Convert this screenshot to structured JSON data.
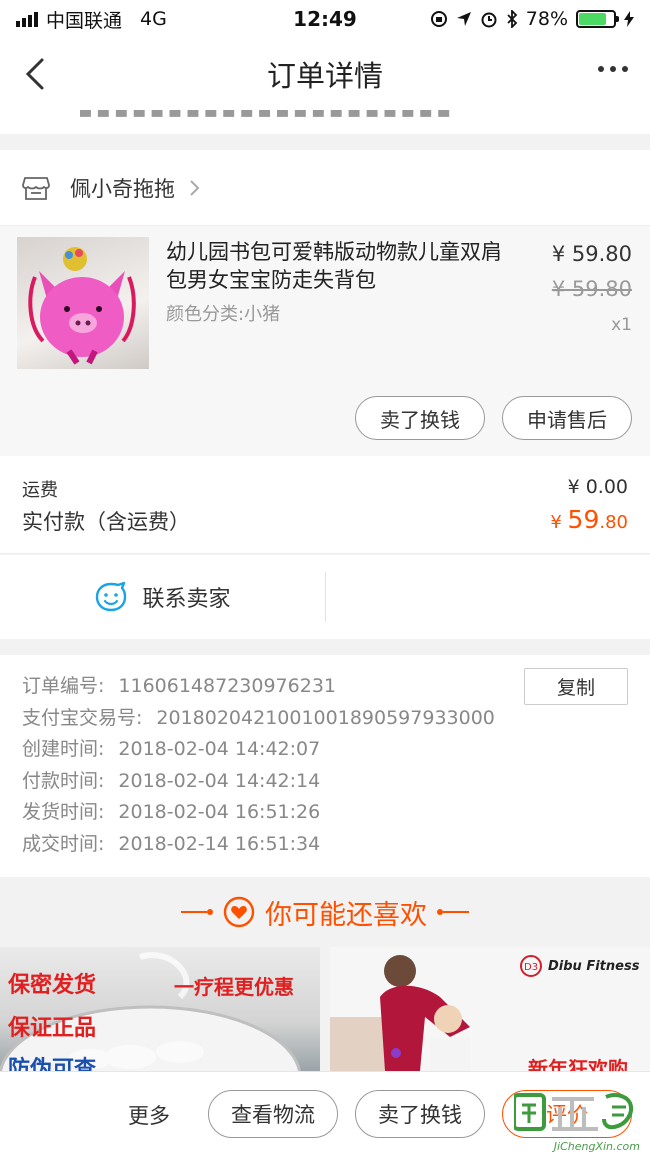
{
  "status_bar": {
    "carrier": "中国联通",
    "network": "4G",
    "time": "12:49",
    "battery": "78%",
    "battery_level": 0.78,
    "battery_color": "#4cd964"
  },
  "nav": {
    "title": "订单详情",
    "back_icon": "chevron-left-icon",
    "more_icon": "more-dots-icon"
  },
  "shop": {
    "name": "佩小奇拖拖",
    "icon": "shop-icon"
  },
  "item": {
    "title": "幼儿园书包可爱韩版动物款儿童双肩包男女宝宝防走失背包",
    "variant": "颜色分类:小猪",
    "price": "¥ 59.80",
    "original_price": "¥ 59.80",
    "quantity": "x1",
    "actions": [
      "卖了换钱",
      "申请售后"
    ]
  },
  "fees": {
    "shipping_label": "运费",
    "shipping_value": "¥ 0.00",
    "paid_label": "实付款（含运费）",
    "paid_symbol": "¥ ",
    "paid_integer": "59",
    "paid_decimal": ".80"
  },
  "contact": {
    "label": "联系卖家",
    "icon": "chat-smile-icon"
  },
  "order_info": {
    "copy_label": "复制",
    "rows": [
      {
        "key": "订单编号:",
        "value": "116061487230976231"
      },
      {
        "key": "支付宝交易号:",
        "value": "2018020421001001890597933000"
      },
      {
        "key": "创建时间:",
        "value": "2018-02-04 14:42:07"
      },
      {
        "key": "付款时间:",
        "value": "2018-02-04 14:42:14"
      },
      {
        "key": "发货时间:",
        "value": "2018-02-04 16:51:26"
      },
      {
        "key": "成交时间:",
        "value": "2018-02-14 16:51:34"
      }
    ]
  },
  "recommend": {
    "title": "你可能还喜欢",
    "left_card": {
      "line1": "保密发货",
      "line2": "一疗程更优惠",
      "line3": "保证正品",
      "line4": "防伪可查"
    },
    "right_card": {
      "brand": "Dibu Fitness",
      "tagline": "新年狂欢购"
    }
  },
  "bottom_bar": {
    "more": "更多",
    "actions": [
      "查看物流",
      "卖了换钱",
      "评价"
    ],
    "accent": "#ff5000"
  },
  "watermark": {
    "text": "JiChengXin.com"
  }
}
